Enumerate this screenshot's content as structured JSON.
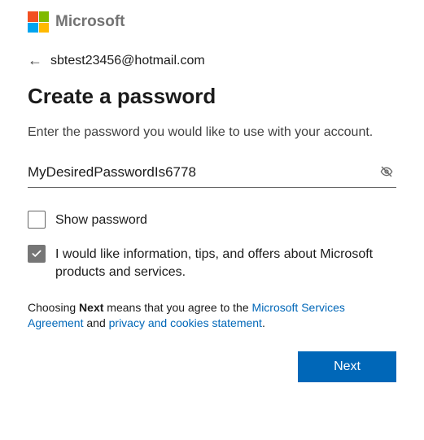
{
  "brand": {
    "name": "Microsoft"
  },
  "identity": {
    "email": "sbtest23456@hotmail.com"
  },
  "page": {
    "title": "Create a password",
    "instruction": "Enter the password you would like to use with your account."
  },
  "form": {
    "password_value": "MyDesiredPasswordIs6778",
    "show_password_label": "Show password",
    "show_password_checked": false,
    "offers_label": "I would like information, tips, and offers about Microsoft products and services.",
    "offers_checked": true
  },
  "legal": {
    "prefix": "Choosing ",
    "bold_word": "Next",
    "mid1": " means that you agree to the ",
    "link1_text": "Microsoft Services Agreement",
    "mid2": " and ",
    "link2_text": "privacy and cookies statement",
    "suffix": "."
  },
  "actions": {
    "next_label": "Next"
  }
}
